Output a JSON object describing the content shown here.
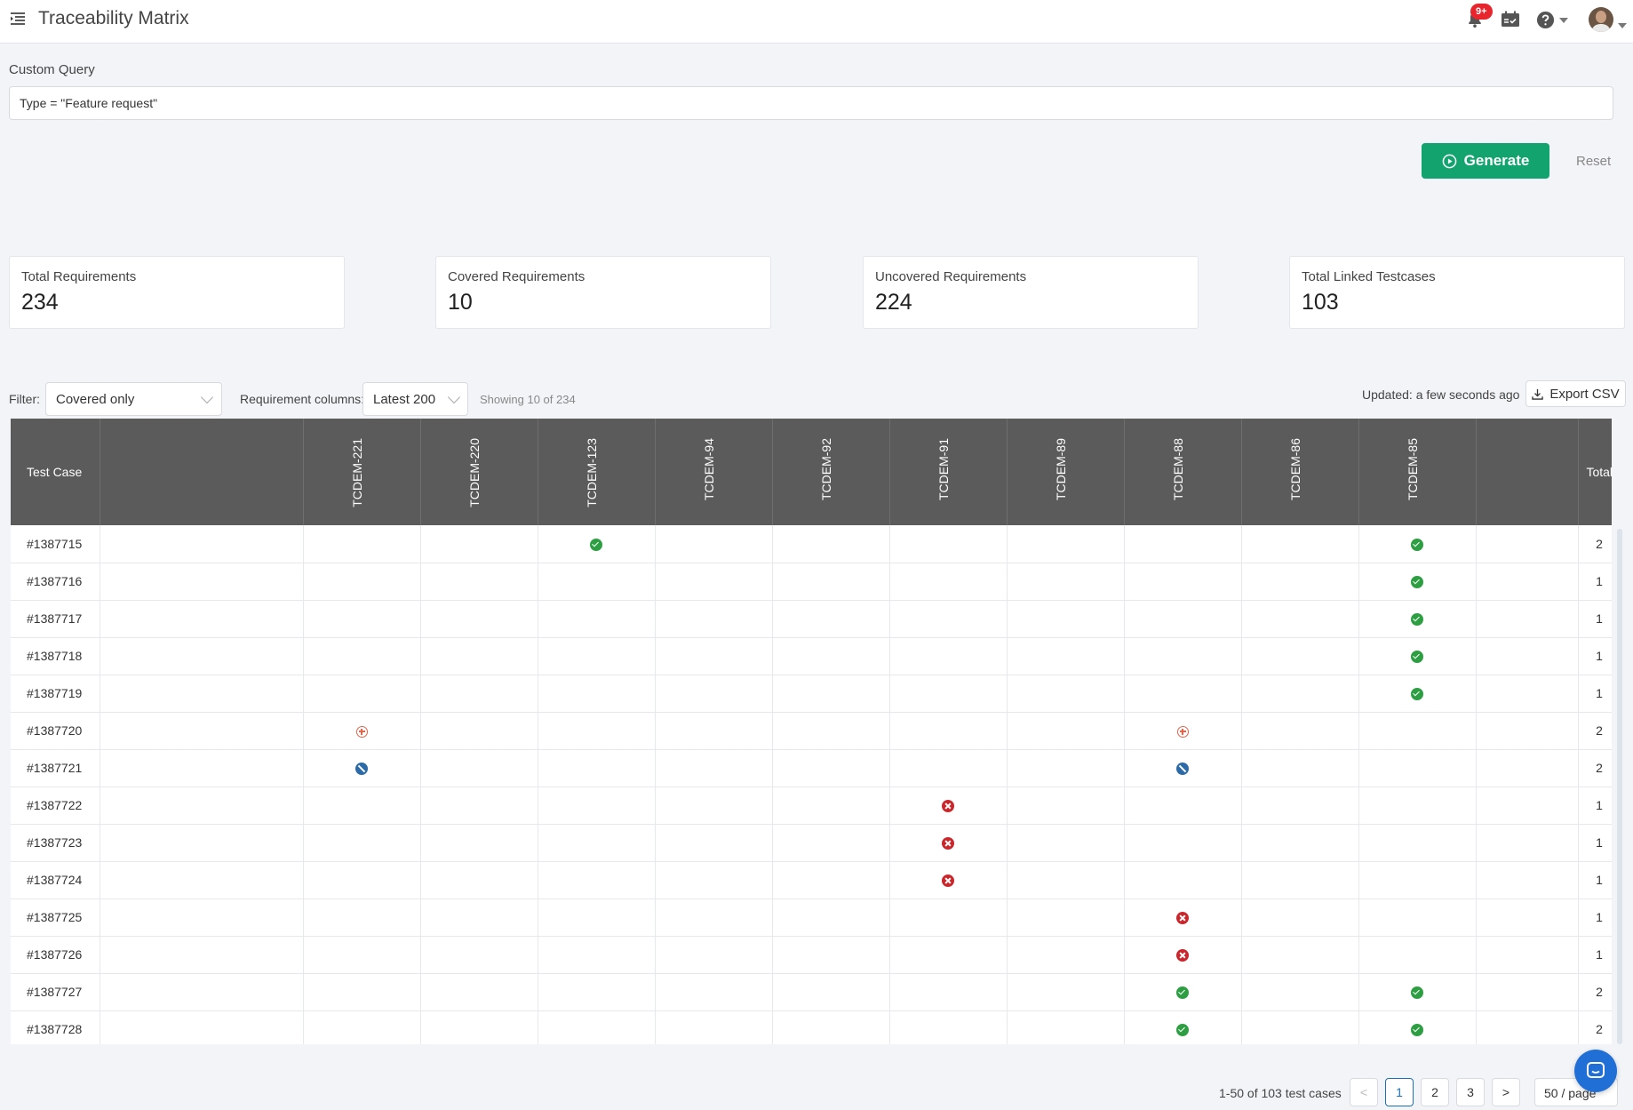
{
  "header": {
    "title": "Traceability Matrix",
    "notification_badge": "9+"
  },
  "query": {
    "label": "Custom Query",
    "value": "Type = \"Feature request\""
  },
  "actions": {
    "generate_label": "Generate",
    "reset_label": "Reset"
  },
  "stats": [
    {
      "label": "Total Requirements",
      "value": "234"
    },
    {
      "label": "Covered Requirements",
      "value": "10"
    },
    {
      "label": "Uncovered Requirements",
      "value": "224"
    },
    {
      "label": "Total Linked Testcases",
      "value": "103"
    }
  ],
  "filters": {
    "filter_label": "Filter:",
    "filter_value": "Covered only",
    "columns_label": "Requirement columns:",
    "columns_value": "Latest 200",
    "showing": "Showing 10 of 234",
    "updated": "Updated: a few seconds ago",
    "export_label": "Export CSV"
  },
  "table": {
    "test_case_header": "Test Case",
    "total_header": "Total",
    "requirements": [
      "TCDEM-221",
      "TCDEM-220",
      "TCDEM-123",
      "TCDEM-94",
      "TCDEM-92",
      "TCDEM-91",
      "TCDEM-89",
      "TCDEM-88",
      "TCDEM-86",
      "TCDEM-85"
    ],
    "rows": [
      {
        "id": "#1387715",
        "cells": {
          "TCDEM-123": "pass",
          "TCDEM-85": "pass"
        },
        "total": "2"
      },
      {
        "id": "#1387716",
        "cells": {
          "TCDEM-85": "pass"
        },
        "total": "1"
      },
      {
        "id": "#1387717",
        "cells": {
          "TCDEM-85": "pass"
        },
        "total": "1"
      },
      {
        "id": "#1387718",
        "cells": {
          "TCDEM-85": "pass"
        },
        "total": "1"
      },
      {
        "id": "#1387719",
        "cells": {
          "TCDEM-85": "pass"
        },
        "total": "1"
      },
      {
        "id": "#1387720",
        "cells": {
          "TCDEM-221": "retest",
          "TCDEM-88": "retest"
        },
        "total": "2"
      },
      {
        "id": "#1387721",
        "cells": {
          "TCDEM-221": "blocked",
          "TCDEM-88": "blocked"
        },
        "total": "2"
      },
      {
        "id": "#1387722",
        "cells": {
          "TCDEM-91": "fail"
        },
        "total": "1"
      },
      {
        "id": "#1387723",
        "cells": {
          "TCDEM-91": "fail"
        },
        "total": "1"
      },
      {
        "id": "#1387724",
        "cells": {
          "TCDEM-91": "fail"
        },
        "total": "1"
      },
      {
        "id": "#1387725",
        "cells": {
          "TCDEM-88": "fail"
        },
        "total": "1"
      },
      {
        "id": "#1387726",
        "cells": {
          "TCDEM-88": "fail"
        },
        "total": "1"
      },
      {
        "id": "#1387727",
        "cells": {
          "TCDEM-88": "pass",
          "TCDEM-85": "pass"
        },
        "total": "2"
      },
      {
        "id": "#1387728",
        "cells": {
          "TCDEM-88": "pass",
          "TCDEM-85": "pass"
        },
        "total": "2"
      }
    ]
  },
  "pagination": {
    "info": "1-50 of 103 test cases",
    "pages": [
      "1",
      "2",
      "3"
    ],
    "current_page": "1",
    "prev_label": "<",
    "next_label": ">",
    "page_size": "50 / page"
  },
  "colors": {
    "accent": "#12a36f",
    "pass": "#2e9e43",
    "fail": "#c9272c",
    "blocked": "#2d6aa8",
    "retest": "#e0674c",
    "header_bg": "#5b5b5b"
  },
  "icons": {
    "menu": "menu-icon",
    "bell": "bell-icon",
    "calendar": "calendar-check-icon",
    "help": "help-icon",
    "generate": "play-circle-icon",
    "export": "download-icon",
    "chat": "chat-icon"
  }
}
